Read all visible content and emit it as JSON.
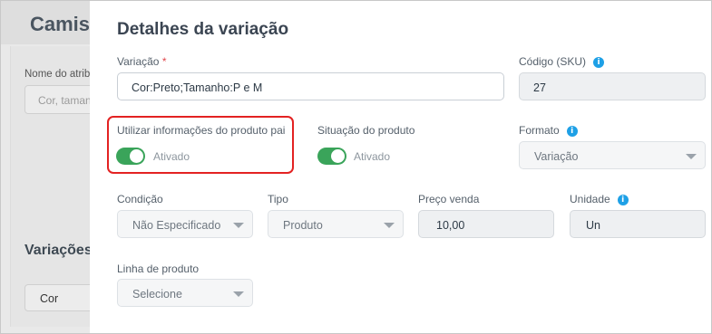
{
  "background": {
    "title": "Camis",
    "attr_label": "Nome do atrib",
    "attr_placeholder": "Cor, taman",
    "section_title": "Variações",
    "section_select": "Cor"
  },
  "modal": {
    "title": "Detalhes da variação",
    "variation": {
      "label": "Variação",
      "required_mark": "*",
      "value": "Cor:Preto;Tamanho:P e M"
    },
    "sku": {
      "label": "Código (SKU)",
      "value": "27"
    },
    "use_parent_info": {
      "label": "Utilizar informações do produto pai",
      "state": "Ativado"
    },
    "product_status": {
      "label": "Situação do produto",
      "state": "Ativado"
    },
    "format": {
      "label": "Formato",
      "value": "Variação"
    },
    "condition": {
      "label": "Condição",
      "value": "Não Especificado"
    },
    "type": {
      "label": "Tipo",
      "value": "Produto"
    },
    "sale_price": {
      "label": "Preço venda",
      "value": "10,00"
    },
    "unit": {
      "label": "Unidade",
      "value": "Un"
    },
    "product_line": {
      "label": "Linha de produto",
      "value": "Selecione"
    }
  },
  "icons": {
    "info": "info-icon",
    "caret": "chevron-down-icon"
  },
  "colors": {
    "toggle_on": "#3aa45a",
    "info": "#1ea0e6",
    "highlight": "#e32222",
    "required": "#e0474c"
  }
}
